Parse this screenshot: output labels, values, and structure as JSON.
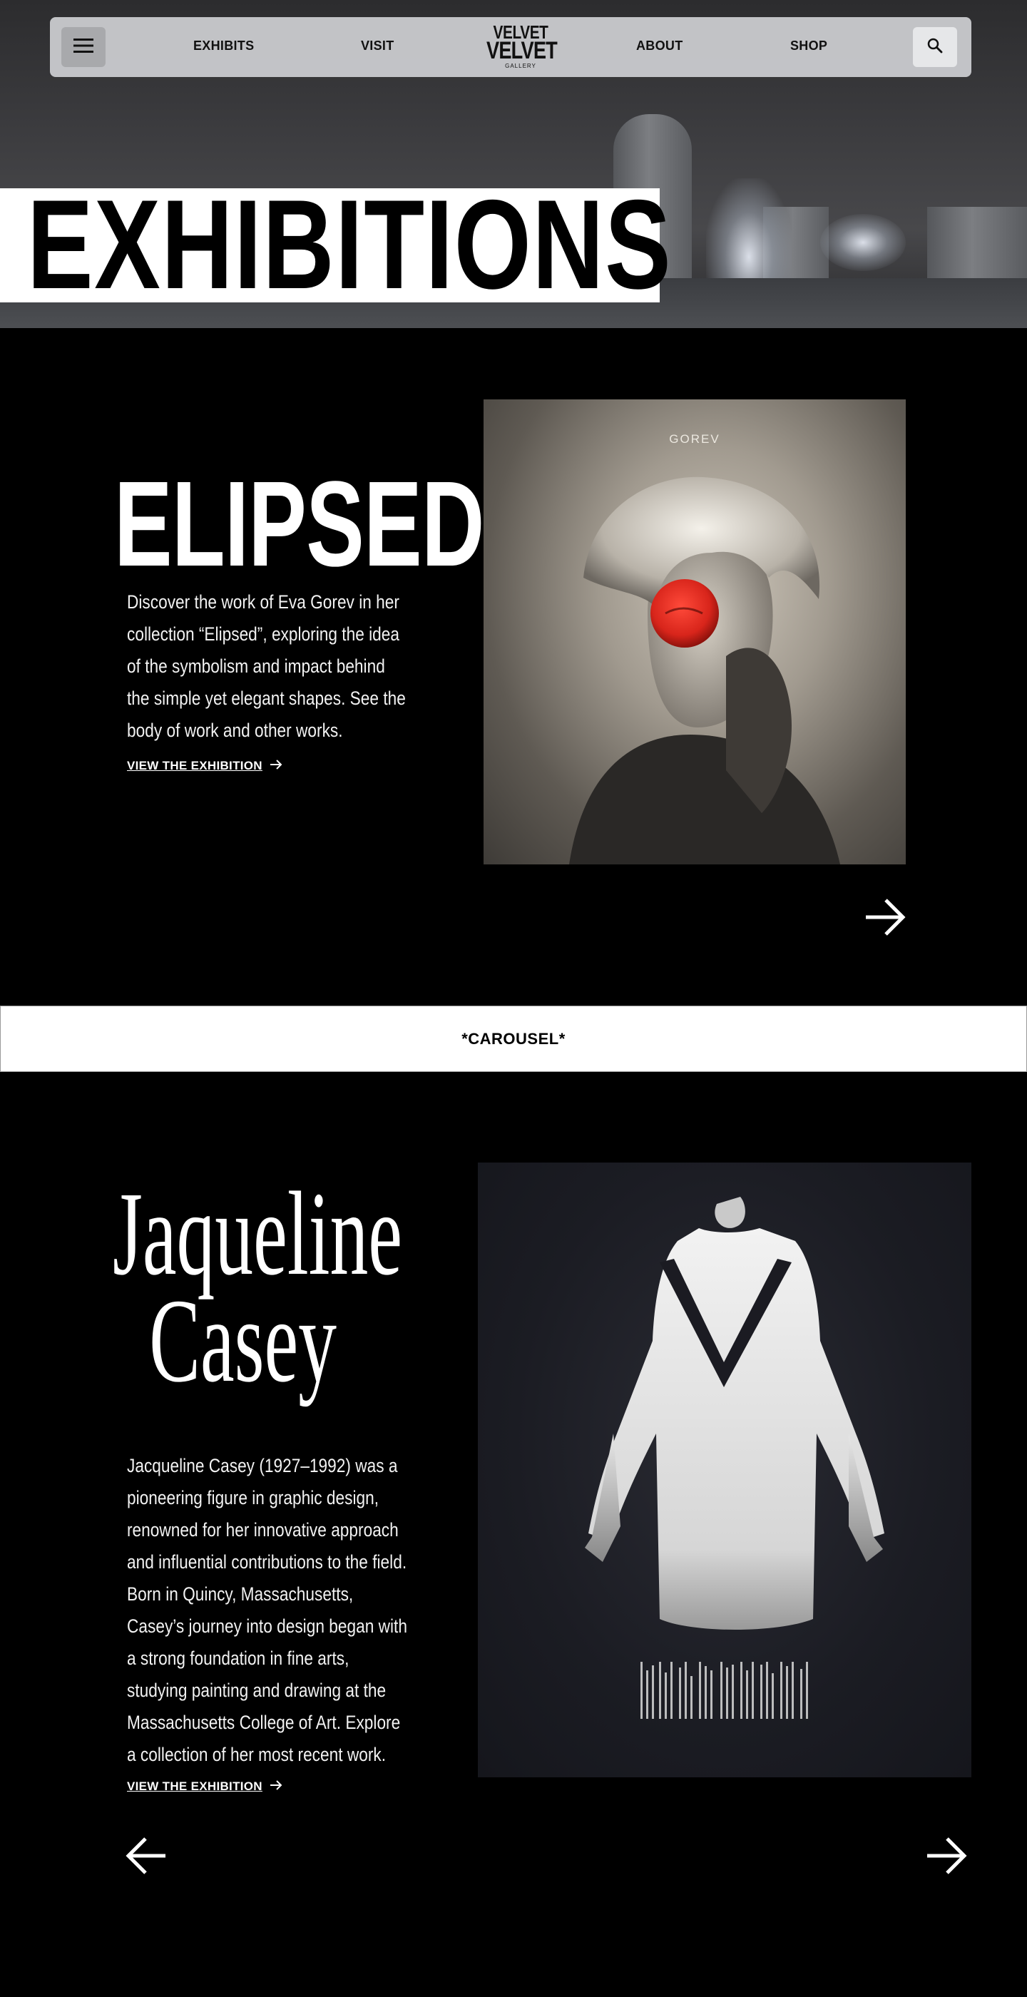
{
  "nav": {
    "links": [
      "EXHIBITS",
      "VISIT",
      "ABOUT",
      "SHOP"
    ],
    "logo": {
      "line1": "VELVET",
      "line2": "VELVET",
      "line3": "GALLERY"
    }
  },
  "hero": {
    "title": "EXHIBITIONS"
  },
  "exhibitions": [
    {
      "title": "ELIPSED:",
      "description": "Discover the work of Eva Gorev in her collection “Elipsed”, exploring the idea of the symbolism and impact behind the simple yet elegant shapes.  See the body of work and other works.",
      "link": "VIEW THE EXHIBITION",
      "poster_text": "GOREV"
    },
    {
      "title_line1": "Jaqueline",
      "title_line2": "Casey",
      "description": "Jacqueline Casey (1927–1992) was a pioneering figure in graphic design, renowned for her innovative approach and influential contributions to the field. Born in Quincy, Massachusetts, Casey’s journey into design began with a strong foundation in fine arts, studying painting and drawing at the Massachusetts College of Art. Explore a collection of her most recent work.",
      "link": "VIEW THE EXHIBITION"
    }
  ],
  "carousel": {
    "label": "*CAROUSEL*"
  },
  "colors": {
    "background": "#000000",
    "accent_red": "#d8251b",
    "nav_bg": "#cdcfd2"
  },
  "icons": [
    "menu-icon",
    "search-icon",
    "arrow-right-icon",
    "arrow-left-icon"
  ]
}
